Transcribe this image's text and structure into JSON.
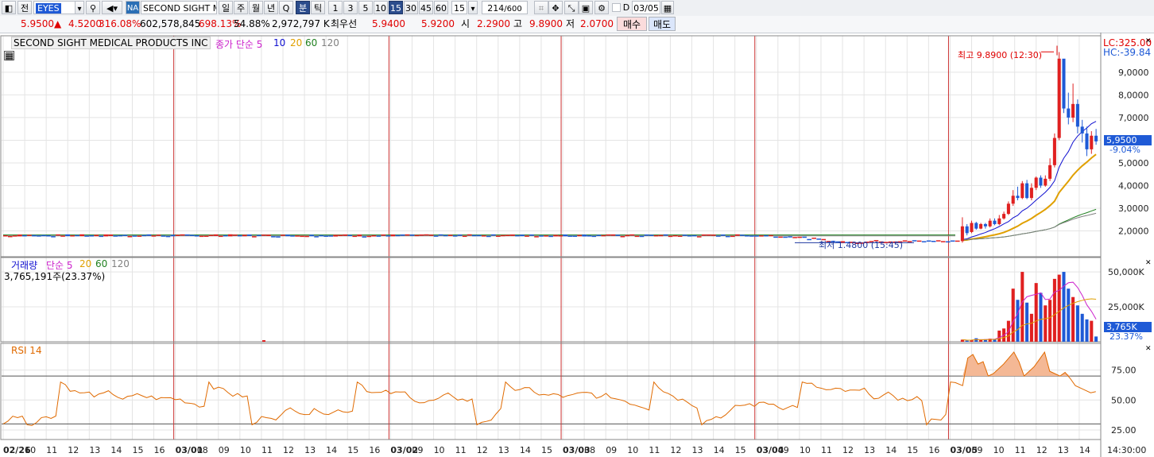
{
  "toolbar": {
    "tab_label": "전",
    "symbol_code": "EYES",
    "market_badge": "NA",
    "stock_name_short": "SECOND SIGHT ME",
    "periods": [
      "일",
      "주",
      "월",
      "년",
      "Q",
      "분",
      "틱"
    ],
    "active_period": "분",
    "intervals": [
      "1",
      "3",
      "5",
      "10",
      "15",
      "30",
      "45",
      "60"
    ],
    "active_interval": "15",
    "interval_select": "15",
    "bar_count": "214",
    "bar_total": "/600",
    "date_value": "03/05"
  },
  "quote": {
    "price": "5.9500",
    "change": "4.5200",
    "change_pct": "316.08%",
    "volume": "602,578,845",
    "volume_ratio": "698.13%",
    "turnover_pct": "54.88%",
    "amount": "2,972,797 K",
    "best_label": "최우선",
    "bid": "5.9400",
    "ask": "5.9200",
    "open_label": "시",
    "open": "2.2900",
    "high_label": "고",
    "high": "9.8900",
    "low_label": "저",
    "low": "2.0700",
    "buy_label": "매수",
    "sell_label": "매도"
  },
  "price_pane": {
    "company": "SECOND SIGHT MEDICAL PRODUCTS INC",
    "indicator": "종가 단순 5",
    "ma_periods": [
      "10",
      "20",
      "60",
      "120"
    ],
    "lc": "LC:325.00",
    "hc": "HC:-39.84",
    "y_ticks": [
      "9,0000",
      "8,0000",
      "7,0000",
      "6,0000",
      "5,0000",
      "4,0000",
      "3,0000",
      "2,0000"
    ],
    "current_price_tag": "5,9500",
    "current_change_tag": "-9.04%",
    "high_annotation": "최고 9.8900 (12:30)",
    "low_annotation": "최저 1.4800 (15:45)"
  },
  "volume_pane": {
    "title": "거래량",
    "indicator": "단순 5",
    "ma_periods": [
      "20",
      "60",
      "120"
    ],
    "value": "3,765,191주(23.37%)",
    "y_ticks": [
      "50,000K",
      "25,000K"
    ],
    "tag_value": "3,765K",
    "tag_pct": "23.37%"
  },
  "rsi_pane": {
    "title": "RSI 14",
    "y_ticks": [
      "75.00",
      "50.00",
      "25.00"
    ]
  },
  "x_axis": {
    "labels": [
      "02/26",
      "10",
      "11",
      "12",
      "13",
      "14",
      "15",
      "16",
      "03/01",
      "08",
      "09",
      "10",
      "11",
      "12",
      "13",
      "14",
      "15",
      "16",
      "03/02",
      "09",
      "10",
      "11",
      "12",
      "13",
      "14",
      "15",
      "03/03",
      "08",
      "09",
      "10",
      "11",
      "12",
      "13",
      "14",
      "15",
      "03/04",
      "09",
      "10",
      "11",
      "12",
      "13",
      "14",
      "15",
      "16",
      "03/05",
      "09",
      "10",
      "11",
      "12",
      "13",
      "14"
    ],
    "time_label": "14:30:00"
  },
  "chart_data": {
    "type": "candlestick",
    "title": "SECOND SIGHT MEDICAL PRODUCTS INC",
    "interval": "15분",
    "ylim": [
      1.0,
      10.4
    ],
    "last_day_candles": [
      {
        "o": 1.55,
        "c": 2.2,
        "h": 2.6,
        "l": 1.48
      },
      {
        "o": 2.2,
        "c": 1.9,
        "h": 2.3,
        "l": 1.8
      },
      {
        "o": 1.95,
        "c": 2.35,
        "h": 2.45,
        "l": 1.9
      },
      {
        "o": 2.35,
        "c": 2.1,
        "h": 2.4,
        "l": 2.05
      },
      {
        "o": 2.1,
        "c": 2.3,
        "h": 2.35,
        "l": 2.07
      },
      {
        "o": 2.3,
        "c": 2.2,
        "h": 2.35,
        "l": 2.1
      },
      {
        "o": 2.2,
        "c": 2.45,
        "h": 2.55,
        "l": 2.15
      },
      {
        "o": 2.45,
        "c": 2.3,
        "h": 2.55,
        "l": 2.25
      },
      {
        "o": 2.3,
        "c": 2.55,
        "h": 2.7,
        "l": 2.25
      },
      {
        "o": 2.55,
        "c": 2.75,
        "h": 2.85,
        "l": 2.5
      },
      {
        "o": 2.75,
        "c": 3.2,
        "h": 3.3,
        "l": 2.7
      },
      {
        "o": 3.2,
        "c": 3.55,
        "h": 3.8,
        "l": 3.1
      },
      {
        "o": 3.55,
        "c": 3.45,
        "h": 3.95,
        "l": 3.35
      },
      {
        "o": 3.45,
        "c": 4.1,
        "h": 4.2,
        "l": 3.4
      },
      {
        "o": 4.1,
        "c": 3.45,
        "h": 4.25,
        "l": 3.4
      },
      {
        "o": 3.45,
        "c": 3.9,
        "h": 4.1,
        "l": 3.35
      },
      {
        "o": 3.9,
        "c": 4.35,
        "h": 4.4,
        "l": 3.8
      },
      {
        "o": 4.35,
        "c": 4.0,
        "h": 4.45,
        "l": 3.9
      },
      {
        "o": 4.0,
        "c": 4.3,
        "h": 4.45,
        "l": 3.95
      },
      {
        "o": 4.3,
        "c": 4.9,
        "h": 5.2,
        "l": 4.2
      },
      {
        "o": 4.9,
        "c": 6.1,
        "h": 6.3,
        "l": 4.8
      },
      {
        "o": 6.1,
        "c": 9.6,
        "h": 9.89,
        "l": 6.0
      },
      {
        "o": 9.6,
        "c": 7.4,
        "h": 9.4,
        "l": 7.2
      },
      {
        "o": 7.4,
        "c": 7.0,
        "h": 8.1,
        "l": 6.7
      },
      {
        "o": 7.0,
        "c": 7.6,
        "h": 8.5,
        "l": 6.8
      },
      {
        "o": 7.6,
        "c": 6.6,
        "h": 7.8,
        "l": 6.3
      },
      {
        "o": 6.6,
        "c": 6.3,
        "h": 6.9,
        "l": 5.9
      },
      {
        "o": 6.3,
        "c": 5.6,
        "h": 6.6,
        "l": 5.3
      },
      {
        "o": 5.6,
        "c": 6.2,
        "h": 6.4,
        "l": 5.4
      },
      {
        "o": 6.2,
        "c": 5.95,
        "h": 6.5,
        "l": 5.8
      }
    ],
    "earlier_level": 1.8,
    "earlier_min": 1.48,
    "volume_last_day_k": [
      1500,
      800,
      1300,
      2500,
      1200,
      1800,
      2200,
      1600,
      8000,
      9500,
      15000,
      38000,
      30000,
      50000,
      28000,
      20000,
      42000,
      35000,
      26000,
      30000,
      45000,
      48000,
      50000,
      38000,
      32000,
      26000,
      20000,
      16000,
      15000,
      3765
    ],
    "rsi_last_day": [
      62,
      85,
      88,
      80,
      82,
      70,
      72,
      76,
      80,
      85,
      90,
      82,
      70,
      74,
      78,
      84,
      90,
      74,
      72,
      70,
      73,
      68,
      62,
      60,
      58,
      56,
      57
    ],
    "rsi_earlier_range": [
      25,
      70
    ],
    "colors": {
      "up": "#e02020",
      "down": "#1f5ad6",
      "ma5": "#cc22cc",
      "ma10": "#1010d0",
      "ma20": "#e0a000",
      "ma60": "#208020",
      "ma120": "#808080",
      "rsi": "#e06a00"
    }
  }
}
